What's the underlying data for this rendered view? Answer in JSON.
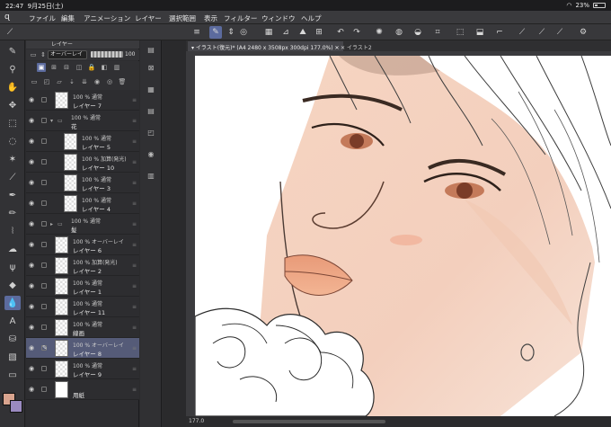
{
  "status": {
    "time": "22:47",
    "date": "9月25日(土)",
    "battery": "23%",
    "battery_level": 0.23
  },
  "menu": {
    "items": [
      "ファイル",
      "編集",
      "アニメーション",
      "レイヤー",
      "選択範囲",
      "表示",
      "フィルター",
      "ウィンドウ",
      "ヘルプ"
    ]
  },
  "tabs": {
    "active": "イラスト(復元)* (A4 2480 x 3508px 300dpi 177.0%)",
    "second": "イラスト2"
  },
  "layer_panel": {
    "title": "レイヤー",
    "blend_mode": "オーバーレイ",
    "opacity": "100",
    "layers": [
      {
        "info": "100 % 通常",
        "name": "レイヤー 7",
        "indent": 0,
        "type": "layer"
      },
      {
        "info": "100 % 通常",
        "name": "花",
        "indent": 0,
        "type": "folder"
      },
      {
        "info": "100 % 通常",
        "name": "レイヤー 5",
        "indent": 1,
        "type": "layer"
      },
      {
        "info": "100 % 加算(発光)",
        "name": "レイヤー 10",
        "indent": 1,
        "type": "layer"
      },
      {
        "info": "100 % 通常",
        "name": "レイヤー 3",
        "indent": 1,
        "type": "layer"
      },
      {
        "info": "100 % 通常",
        "name": "レイヤー 4",
        "indent": 1,
        "type": "layer"
      },
      {
        "info": "100 % 通常",
        "name": "髪",
        "indent": 0,
        "type": "folder-closed"
      },
      {
        "info": "100 % オーバーレイ",
        "name": "レイヤー 6",
        "indent": 0,
        "type": "layer"
      },
      {
        "info": "100 % 加算(発光)",
        "name": "レイヤー 2",
        "indent": 0,
        "type": "layer"
      },
      {
        "info": "100 % 通常",
        "name": "レイヤー 1",
        "indent": 0,
        "type": "layer"
      },
      {
        "info": "100 % 通常",
        "name": "レイヤー 11",
        "indent": 0,
        "type": "layer"
      },
      {
        "info": "100 % 通常",
        "name": "線画",
        "indent": 0,
        "type": "layer"
      },
      {
        "info": "100 % オーバーレイ",
        "name": "レイヤー 8",
        "indent": 0,
        "type": "layer",
        "selected": true
      },
      {
        "info": "100 % 通常",
        "name": "レイヤー 9",
        "indent": 0,
        "type": "layer"
      },
      {
        "info": "",
        "name": "用紙",
        "indent": 0,
        "type": "paper"
      }
    ]
  },
  "colors": {
    "main": "#d9a48f",
    "sub": "#9a8ac0",
    "accent": "#5c6b9e"
  },
  "zoom": "177.0"
}
